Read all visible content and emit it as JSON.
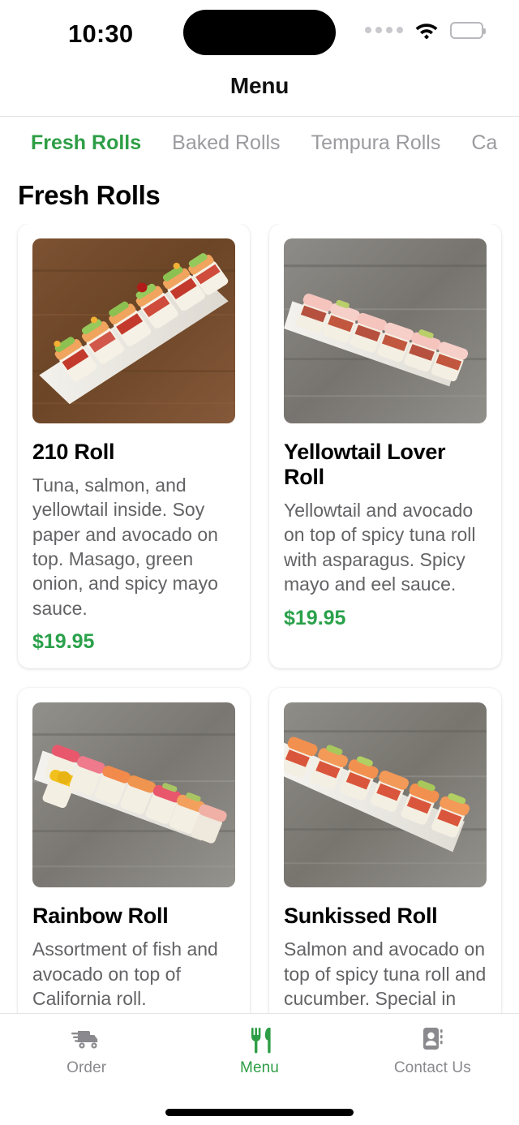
{
  "status_bar": {
    "time": "10:30",
    "cellular_icon": "signal-dots-icon",
    "wifi_icon": "wifi-icon",
    "battery_icon": "battery-full-icon"
  },
  "nav": {
    "title": "Menu"
  },
  "categories": {
    "items": [
      {
        "label": "Fresh Rolls",
        "active": true
      },
      {
        "label": "Baked Rolls",
        "active": false
      },
      {
        "label": "Tempura Rolls",
        "active": false
      },
      {
        "label": "Ca",
        "active": false
      }
    ]
  },
  "section": {
    "title": "Fresh Rolls"
  },
  "menu_items": [
    {
      "name": "210 Roll",
      "description": "Tuna, salmon, and yellowtail inside. Soy paper and avocado on top. Masago, green onion, and spicy mayo sauce.",
      "price": "$19.95",
      "photo": "sushi-roll-on-dark-wood-photo"
    },
    {
      "name": "Yellowtail Lover Roll",
      "description": "Yellowtail and avocado on top of spicy tuna roll with asparagus. Spicy mayo and eel sauce.",
      "price": "$19.95",
      "photo": "yellowtail-sushi-on-gray-wood-photo"
    },
    {
      "name": "Rainbow Roll",
      "description": "Assortment of fish and avocado on top of California roll.",
      "price": "",
      "photo": "rainbow-sushi-on-gray-wood-photo"
    },
    {
      "name": "Sunkissed Roll",
      "description": "Salmon and avocado on top of spicy tuna roll and cucumber. Special in house sauce.",
      "price": "",
      "photo": "salmon-avocado-sushi-on-gray-wood-photo"
    }
  ],
  "tabbar": {
    "items": [
      {
        "label": "Order",
        "icon": "delivery-truck-icon",
        "active": false
      },
      {
        "label": "Menu",
        "icon": "fork-knife-icon",
        "active": true
      },
      {
        "label": "Contact Us",
        "icon": "contact-card-icon",
        "active": false
      }
    ]
  },
  "colors": {
    "accent_green": "#2e9e46",
    "price_green": "#2aa14a",
    "inactive_gray": "#9b9b9f",
    "description_gray": "#636366"
  }
}
